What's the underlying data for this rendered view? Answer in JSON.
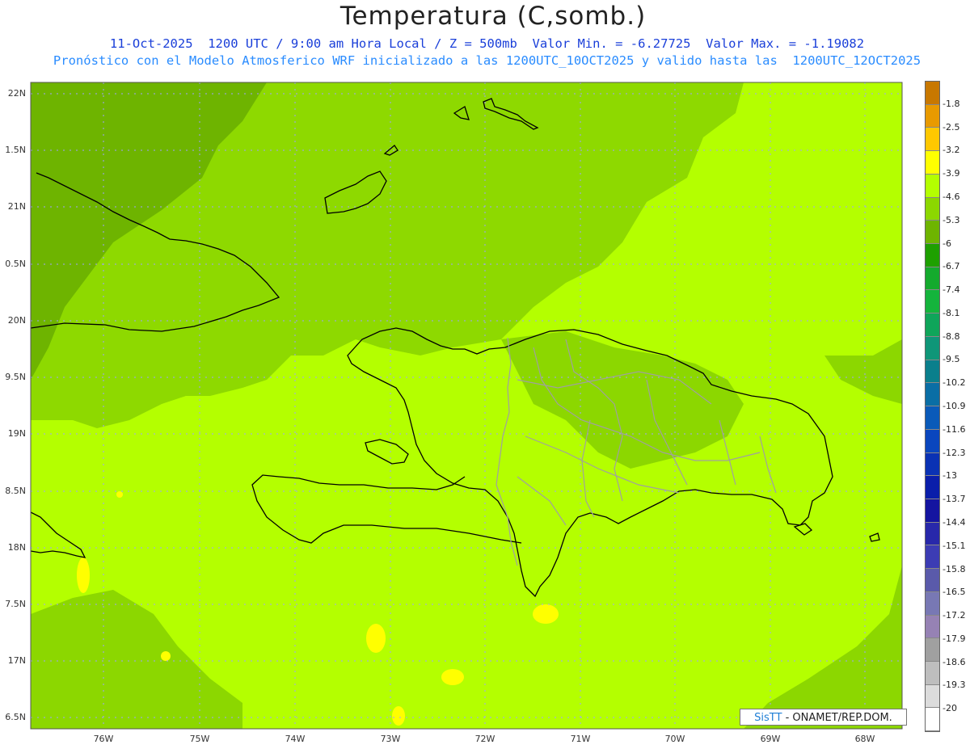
{
  "header": {
    "title": "Temperatura (C,somb.)",
    "subtitle1": "11-Oct-2025  1200 UTC / 9:00 am Hora Local / Z = 500mb  Valor Min. = -6.27725  Valor Max. = -1.19082",
    "subtitle2": "Pronóstico con el Modelo Atmosferico WRF inicializado a las 1200UTC_10OCT2025 y valido hasta las  1200UTC_12OCT2025"
  },
  "axes": {
    "lat_labels": [
      "22N",
      "1.5N",
      "21N",
      "0.5N",
      "20N",
      "9.5N",
      "19N",
      "8.5N",
      "18N",
      "7.5N",
      "17N",
      "6.5N"
    ],
    "lon_labels": [
      "76W",
      "75W",
      "74W",
      "73W",
      "72W",
      "71W",
      "70W",
      "69W",
      "68W"
    ]
  },
  "colorbar": {
    "labels": [
      "-1.8",
      "-2.5",
      "-3.2",
      "-3.9",
      "-4.6",
      "-5.3",
      "-6",
      "-6.7",
      "-7.4",
      "-8.1",
      "-8.8",
      "-9.5",
      "-10.2",
      "-10.9",
      "-11.6",
      "-12.3",
      "-13",
      "-13.7",
      "-14.4",
      "-15.1",
      "-15.8",
      "-16.5",
      "-17.2",
      "-17.9",
      "-18.6",
      "-19.3",
      "-20"
    ],
    "colors": [
      "#c87800",
      "#e89a00",
      "#ffc800",
      "#ffff00",
      "#b4ff00",
      "#8cd700",
      "#6eb400",
      "#1ea000",
      "#14aa2d",
      "#14b43c",
      "#0fa55a",
      "#0f9678",
      "#0a7f8c",
      "#0a6ea5",
      "#0a5ab9",
      "#0a46be",
      "#0a32b4",
      "#0a1eaa",
      "#1414a0",
      "#2828aa",
      "#3c3cb4",
      "#5a5aaa",
      "#7878b4",
      "#9682b4",
      "#a0a0a0",
      "#bebebe",
      "#dcdcdc",
      "#ffffff"
    ]
  },
  "credit": {
    "brand": "SisTT",
    "text": " - ONAMET/REP.DOM."
  }
}
